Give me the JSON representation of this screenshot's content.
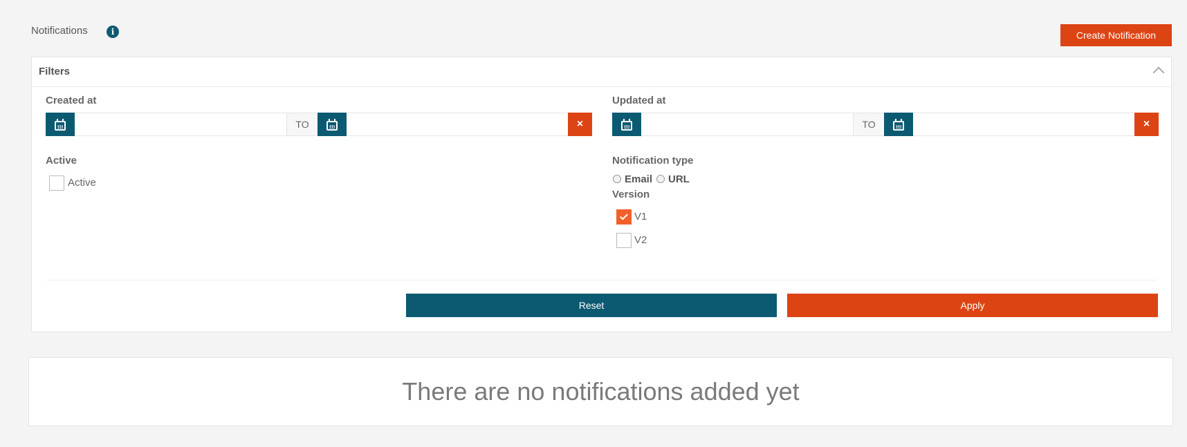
{
  "header": {
    "title": "Notifications",
    "info_icon": "i",
    "create_label": "Create Notification"
  },
  "filters": {
    "title": "Filters",
    "created_at": {
      "label": "Created at",
      "to_label": "TO",
      "from_value": "",
      "to_value": "",
      "clear_symbol": "×"
    },
    "updated_at": {
      "label": "Updated at",
      "to_label": "TO",
      "from_value": "",
      "to_value": "",
      "clear_symbol": "×"
    },
    "active": {
      "label": "Active",
      "option_label": "Active",
      "checked": false
    },
    "notification_type": {
      "label": "Notification type",
      "options": [
        "Email",
        "URL"
      ]
    },
    "version": {
      "label": "Version",
      "options": [
        {
          "label": "V1",
          "checked": true
        },
        {
          "label": "V2",
          "checked": false
        }
      ]
    },
    "reset_label": "Reset",
    "apply_label": "Apply"
  },
  "empty_state": {
    "message": "There are no notifications added yet"
  },
  "colors": {
    "primary": "#0c5a72",
    "accent": "#dd4414",
    "checked": "#f0612a"
  }
}
